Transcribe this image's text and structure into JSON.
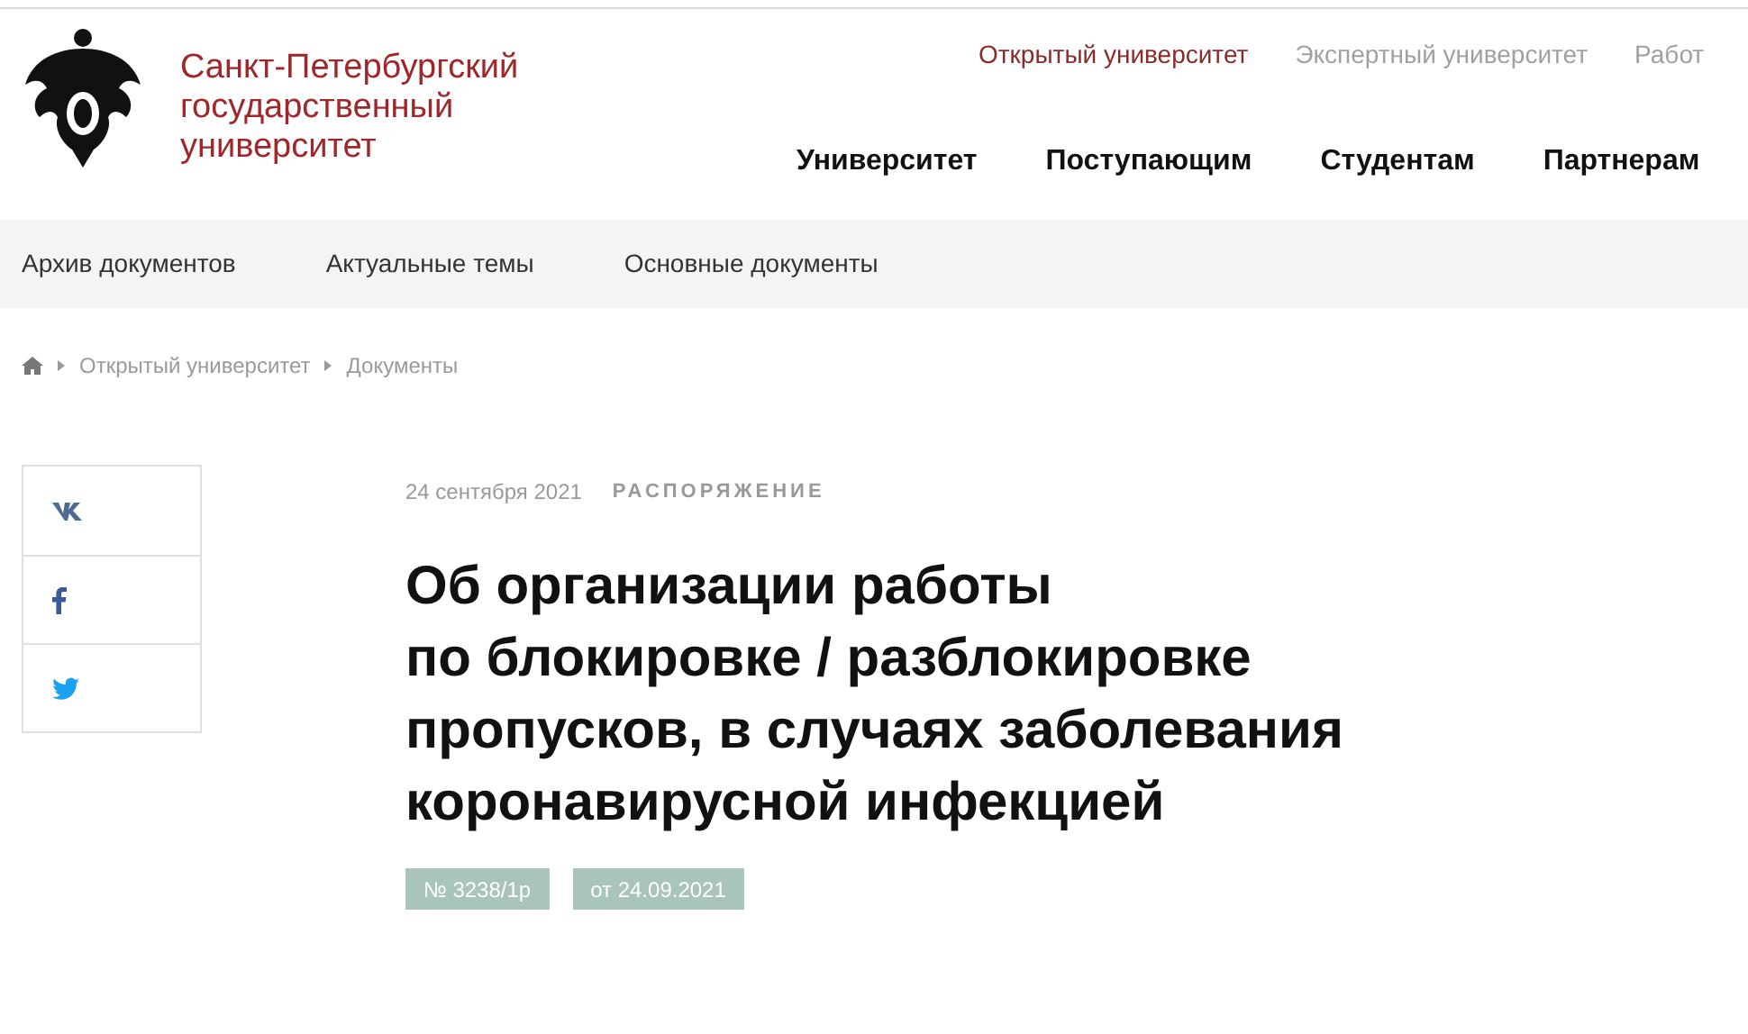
{
  "logo": {
    "text_lines": [
      "Санкт-Петербургский",
      "государственный",
      "университет"
    ]
  },
  "top_links": [
    {
      "label": "Открытый университет",
      "selected": true
    },
    {
      "label": "Экспертный университет",
      "selected": false
    },
    {
      "label": "Работ",
      "selected": false
    }
  ],
  "main_nav": [
    "Университет",
    "Поступающим",
    "Студентам",
    "Партнерам"
  ],
  "sub_nav": [
    "Архив документов",
    "Актуальные темы",
    "Основные документы"
  ],
  "breadcrumbs": [
    "Открытый университет",
    "Документы"
  ],
  "share": [
    {
      "kind": "vk"
    },
    {
      "kind": "facebook"
    },
    {
      "kind": "twitter"
    }
  ],
  "article": {
    "date": "24 сентября 2021",
    "category": "РАСПОРЯЖЕНИЕ",
    "title_lines": [
      "Об организации работы",
      "по блокировке / разблокировке",
      "пропусков, в случаях заболевания",
      "коронавирусной инфекцией"
    ],
    "tags": [
      "№ 3238/1р",
      "от 24.09.2021"
    ]
  }
}
